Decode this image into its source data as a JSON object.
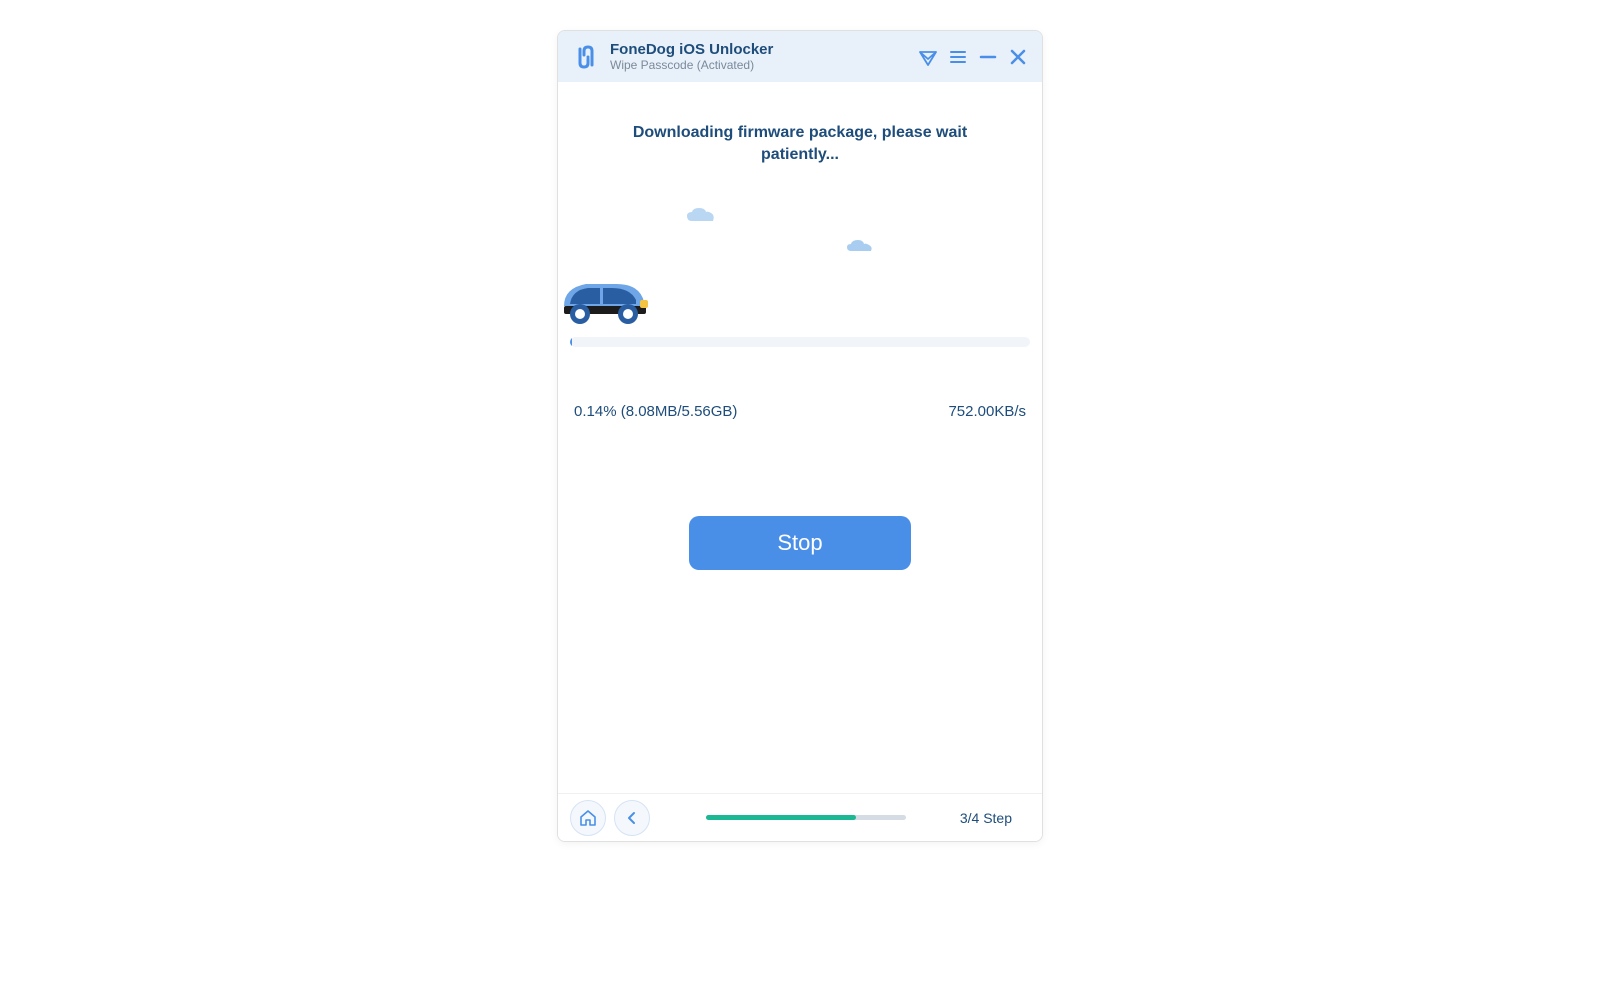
{
  "titlebar": {
    "app_name": "FoneDog iOS Unlocker",
    "subtitle": "Wipe Passcode  (Activated)"
  },
  "main": {
    "status_text": "Downloading firmware package, please wait patiently...",
    "progress_text": "0.14% (8.08MB/5.56GB)",
    "speed_text": "752.00KB/s",
    "stop_label": "Stop"
  },
  "footer": {
    "step_label": "3/4 Step"
  }
}
